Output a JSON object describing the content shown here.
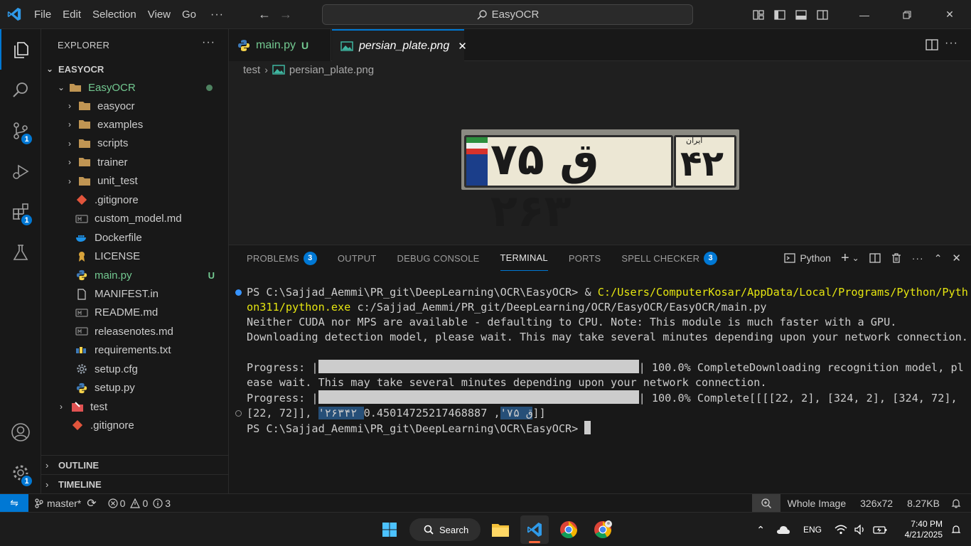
{
  "titlebar": {
    "menu": [
      "File",
      "Edit",
      "Selection",
      "View",
      "Go"
    ],
    "more": "···",
    "search_text": "EasyOCR"
  },
  "activity": {
    "source_control_badge": "1",
    "extensions_badge": "1",
    "manage_badge": "1"
  },
  "explorer": {
    "title": "EXPLORER",
    "more": "···",
    "root": "EASYOCR",
    "folder": "EasyOCR",
    "items": [
      {
        "label": "easyocr",
        "kind": "folder"
      },
      {
        "label": "examples",
        "kind": "folder"
      },
      {
        "label": "scripts",
        "kind": "folder"
      },
      {
        "label": "trainer",
        "kind": "folder"
      },
      {
        "label": "unit_test",
        "kind": "folder"
      },
      {
        "label": ".gitignore",
        "kind": "git"
      },
      {
        "label": "custom_model.md",
        "kind": "md"
      },
      {
        "label": "Dockerfile",
        "kind": "docker"
      },
      {
        "label": "LICENSE",
        "kind": "license"
      },
      {
        "label": "main.py",
        "kind": "python",
        "status": "U"
      },
      {
        "label": "MANIFEST.in",
        "kind": "file"
      },
      {
        "label": "README.md",
        "kind": "md"
      },
      {
        "label": "releasenotes.md",
        "kind": "md"
      },
      {
        "label": "requirements.txt",
        "kind": "pip"
      },
      {
        "label": "setup.cfg",
        "kind": "gear"
      },
      {
        "label": "setup.py",
        "kind": "python"
      }
    ],
    "test_folder": "test",
    "root_gitignore": ".gitignore",
    "outline": "OUTLINE",
    "timeline": "TIMELINE"
  },
  "tabs": [
    {
      "label": "main.py",
      "status": "U"
    },
    {
      "label": "persian_plate.png",
      "close": "✕"
    }
  ],
  "breadcrumb": {
    "folder": "test",
    "file": "persian_plate.png"
  },
  "plate": {
    "main_text": "۷۵ ق ۲۶۳",
    "region_text": "۴۲",
    "region_label": "ایران"
  },
  "panel": {
    "tabs": [
      {
        "label": "PROBLEMS",
        "badge": "3"
      },
      {
        "label": "OUTPUT"
      },
      {
        "label": "DEBUG CONSOLE"
      },
      {
        "label": "TERMINAL"
      },
      {
        "label": "PORTS"
      },
      {
        "label": "SPELL CHECKER",
        "badge": "3"
      }
    ],
    "shell_label": "Python"
  },
  "terminal": {
    "l1_prompt": "PS C:\\Sajjad_Aemmi\\PR_git\\DeepLearning\\OCR\\EasyOCR> & ",
    "l1_exe": "C:/Users/ComputerKosar/AppData/Local/Programs/Python/Pyth",
    "l2_exe": "on311/python.exe",
    "l2_rest": " c:/Sajjad_Aemmi/PR_git/DeepLearning/OCR/EasyOCR/EasyOCR/main.py",
    "l3": "Neither CUDA nor MPS are available - defaulting to CPU. Note: This module is much faster with a GPU.",
    "l4": "Downloading detection model, please wait. This may take several minutes depending upon your network connection.",
    "l6_pre": "Progress: |",
    "l6_post": "| 100.0% CompleteDownloading recognition model, pl",
    "l7": "ease wait. This may take several minutes depending upon your network connection.",
    "l8_pre": "Progress: |",
    "l8_post": "| 100.0% Complete[[[[22, 2], [324, 2], [324, 72],",
    "l9_pre": "[22, 72]], ",
    "l9_sel": "'۲۶۳۴۲ ق ۷۵'",
    "l9_post": ", 0.45014725217468887]]",
    "l10_prompt": "PS C:\\Sajjad_Aemmi\\PR_git\\DeepLearning\\OCR\\EasyOCR> "
  },
  "statusbar": {
    "branch": "master*",
    "errors": "0",
    "warnings": "0",
    "infos": "3",
    "image_mode": "Whole Image",
    "dimensions": "326x72",
    "size": "8.27KB"
  },
  "taskbar": {
    "search": "Search",
    "lang": "ENG",
    "time": "7:40 PM",
    "date": "4/21/2025"
  },
  "colors": {
    "accent": "#0078d4",
    "git_untracked": "#73c991",
    "terminal_yellow": "#e5e510"
  }
}
